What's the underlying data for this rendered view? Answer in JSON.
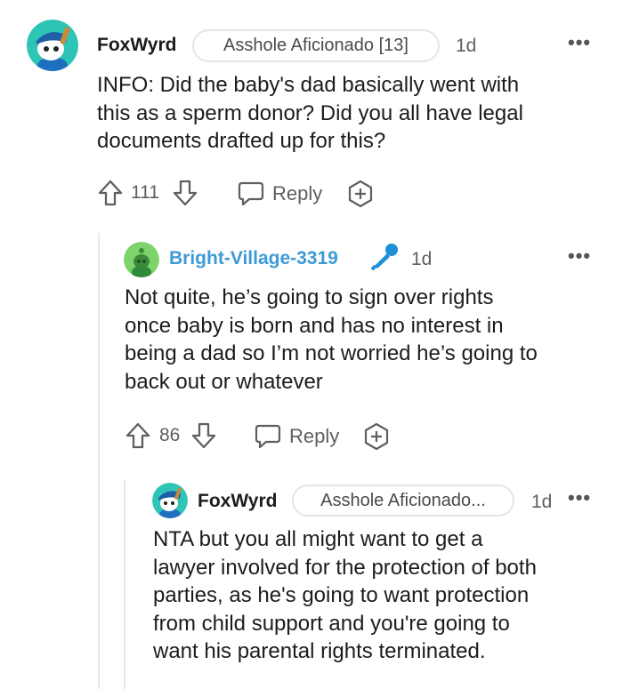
{
  "comments": [
    {
      "username": "FoxWyrd",
      "flair": "Asshole Aficionado [13]",
      "time": "1d",
      "body_lines": [
        "INFO: Did the baby's dad basically went with",
        "this as a sperm donor? Did you all have legal",
        "documents drafted up for this?"
      ],
      "score": "111",
      "reply_label": "Reply",
      "more_label": "•••"
    },
    {
      "username": "Bright-Village-3319",
      "username_color": "#3d9ad8",
      "badge_icon": "microphone-icon",
      "time": "1d",
      "body_lines": [
        "Not quite, he’s going to sign over rights",
        "once baby is born and has no interest in",
        "being a dad so I’m not worried he’s going to",
        "back out or whatever"
      ],
      "score": "86",
      "reply_label": "Reply",
      "more_label": "•••"
    },
    {
      "username": "FoxWyrd",
      "flair": "Asshole Aficionado...",
      "time": "1d",
      "body_lines": [
        "NTA but you all might want to get a",
        "lawyer involved for the protection of both",
        "parties, as he's going to want protection",
        "from child support and you're going to",
        "want his parental rights terminated."
      ],
      "more_label": "•••"
    }
  ]
}
